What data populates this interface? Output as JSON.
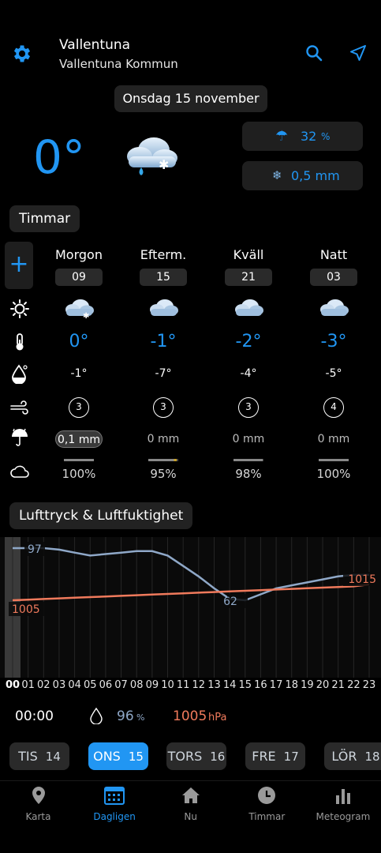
{
  "header": {
    "city": "Vallentuna",
    "municipality": "Vallentuna Kommun",
    "date": "Onsdag 15 november"
  },
  "current": {
    "temp": "0°",
    "precip_chance": "32",
    "precip_chance_unit": "%",
    "precip_amount": "0,5 mm",
    "icon": "cloud-snow-rain-icon"
  },
  "hours_section": {
    "title": "Timmar",
    "columns": [
      {
        "label": "Morgon",
        "hour": "09",
        "temp": "0°",
        "feels": "-1°",
        "wind": "3",
        "precip": "0,1 mm",
        "cloud": "100%",
        "cloud_fill": 1.0
      },
      {
        "label": "Efterm.",
        "hour": "15",
        "temp": "-1°",
        "feels": "-7°",
        "wind": "3",
        "precip": "0 mm",
        "cloud": "95%",
        "cloud_fill": 0.95
      },
      {
        "label": "Kväll",
        "hour": "21",
        "temp": "-2°",
        "feels": "-4°",
        "wind": "3",
        "precip": "0 mm",
        "cloud": "98%",
        "cloud_fill": 0.98
      },
      {
        "label": "Natt",
        "hour": "03",
        "temp": "-3°",
        "feels": "-5°",
        "wind": "4",
        "precip": "0 mm",
        "cloud": "100%",
        "cloud_fill": 1.0
      }
    ]
  },
  "pressure_section": {
    "title": "Lufttryck & Luftfuktighet",
    "humidity_start_label": "97",
    "humidity_min_label": "62",
    "pressure_start_label": "1005",
    "pressure_end_label": "1015",
    "hours": [
      "00",
      "01",
      "02",
      "03",
      "04",
      "05",
      "06",
      "07",
      "08",
      "09",
      "10",
      "11",
      "12",
      "13",
      "14",
      "15",
      "16",
      "17",
      "18",
      "19",
      "20",
      "21",
      "22",
      "23"
    ],
    "selected_time": "00:00",
    "selected_humidity": "96",
    "selected_humidity_unit": "%",
    "selected_pressure": "1005",
    "selected_pressure_unit": "hPa"
  },
  "chart_data": {
    "type": "line",
    "x": [
      "00",
      "01",
      "02",
      "03",
      "04",
      "05",
      "06",
      "07",
      "08",
      "09",
      "10",
      "11",
      "12",
      "13",
      "14",
      "15",
      "16",
      "17",
      "18",
      "19",
      "20",
      "21",
      "22",
      "23"
    ],
    "series": [
      {
        "name": "",
        "values": [
          97,
          97,
          97,
          96,
          94,
          92,
          93,
          94,
          95,
          95,
          92,
          85,
          78,
          70,
          63,
          62,
          66,
          70,
          72,
          74,
          76,
          78,
          79,
          79
        ],
        "color": "#8fa8c8"
      },
      {
        "name": "",
        "values": [
          1005,
          1005.4,
          1005.8,
          1006.2,
          1006.6,
          1007,
          1007.4,
          1007.8,
          1008.2,
          1008.6,
          1009,
          1009.4,
          1009.8,
          1010.2,
          1010.6,
          1011,
          1011.4,
          1011.8,
          1012.2,
          1012.6,
          1013,
          1013.4,
          1013.8,
          1015
        ],
        "color": "#f07a5c"
      }
    ]
  },
  "day_tabs": [
    {
      "day": "TIS",
      "num": "14"
    },
    {
      "day": "ONS",
      "num": "15"
    },
    {
      "day": "TORS",
      "num": "16"
    },
    {
      "day": "FRE",
      "num": "17"
    },
    {
      "day": "LÖR",
      "num": "18"
    }
  ],
  "bottom_nav": [
    {
      "label": "Karta",
      "icon": "map-pin-icon"
    },
    {
      "label": "Dagligen",
      "icon": "calendar-icon"
    },
    {
      "label": "Nu",
      "icon": "home-icon"
    },
    {
      "label": "Timmar",
      "icon": "clock-icon"
    },
    {
      "label": "Meteogram",
      "icon": "bar-chart-icon"
    }
  ],
  "colors": {
    "accent": "#2196f3",
    "humidity": "#8fa8c8",
    "pressure": "#f07a5c"
  }
}
